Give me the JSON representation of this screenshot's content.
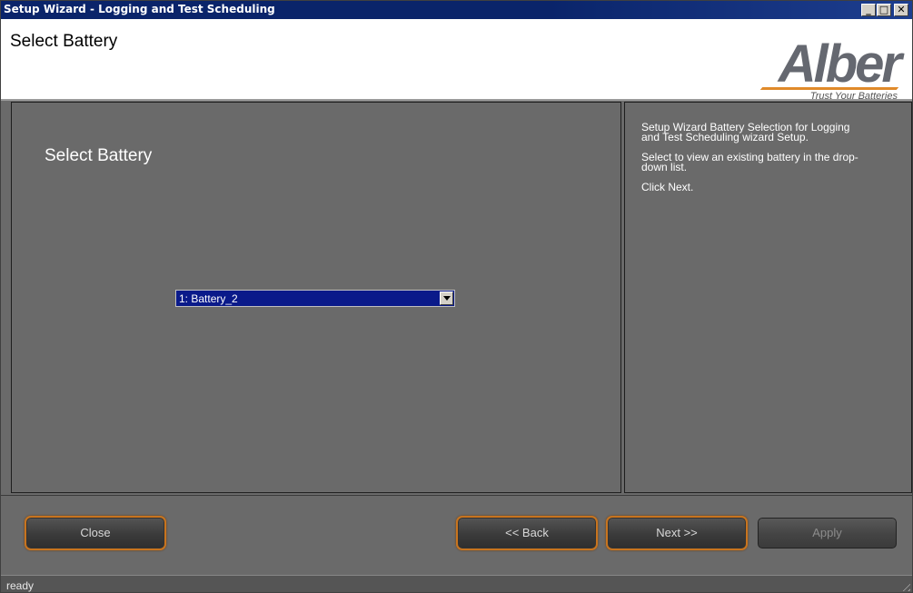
{
  "window": {
    "title": "Setup Wizard - Logging and Test Scheduling",
    "controls": {
      "minimize": "_",
      "maximize": "□",
      "close": "✕"
    }
  },
  "header": {
    "title": "Select Battery",
    "logo": {
      "word": "Alber",
      "tagline": "Trust Your Batteries"
    }
  },
  "main": {
    "panel_title": "Select Battery",
    "battery_select": {
      "selected": "1: Battery_2"
    }
  },
  "help": {
    "paragraphs": [
      "Setup Wizard Battery Selection for Logging and Test Scheduling wizard Setup.",
      "Select to view an existing battery in the drop-down list.",
      "Click Next."
    ]
  },
  "buttons": {
    "close": "Close",
    "back": "<< Back",
    "next": "Next >>",
    "apply": "Apply"
  },
  "status": {
    "text": "ready"
  },
  "colors": {
    "titlebar": "#0a246a",
    "panel_bg": "#6a6a6a",
    "button_accent": "#c8741e",
    "selection": "#0a1a8a"
  }
}
